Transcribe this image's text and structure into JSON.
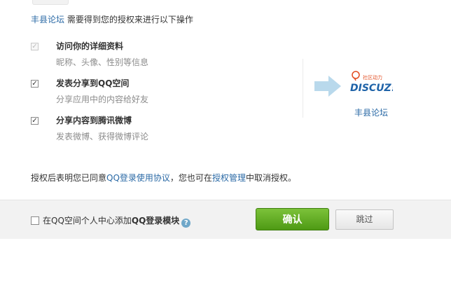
{
  "header": {
    "site_link": "丰县论坛",
    "request_text": " 需要得到您的授权来进行以下操作"
  },
  "permissions": [
    {
      "title": "访问你的详细资料",
      "desc": "昵称、头像、性别等信息",
      "checked": true,
      "disabled": true
    },
    {
      "title": "发表分享到QQ空间",
      "desc": "分享应用中的内容给好友",
      "checked": true,
      "disabled": false
    },
    {
      "title": "分享内容到腾讯微博",
      "desc": "发表微博、获得微博评论",
      "checked": true,
      "disabled": false
    }
  ],
  "logo": {
    "main_text": "DISCUZ!",
    "small_text": "社区动力",
    "brand_color": "#1f63a8",
    "accent": "#e24b1f"
  },
  "site_name": "丰县论坛",
  "agreement": {
    "prefix": "授权后表明您已同意",
    "protocol_link": "QQ登录使用协议",
    "middle": "，您也可在",
    "manage_link": "授权管理",
    "suffix": "中取消授权。"
  },
  "footer": {
    "option_prefix": "在QQ空间个人中心添加",
    "option_bold": "QQ登录模块",
    "help_glyph": "?",
    "confirm_label": "确认",
    "skip_label": "跳过"
  }
}
